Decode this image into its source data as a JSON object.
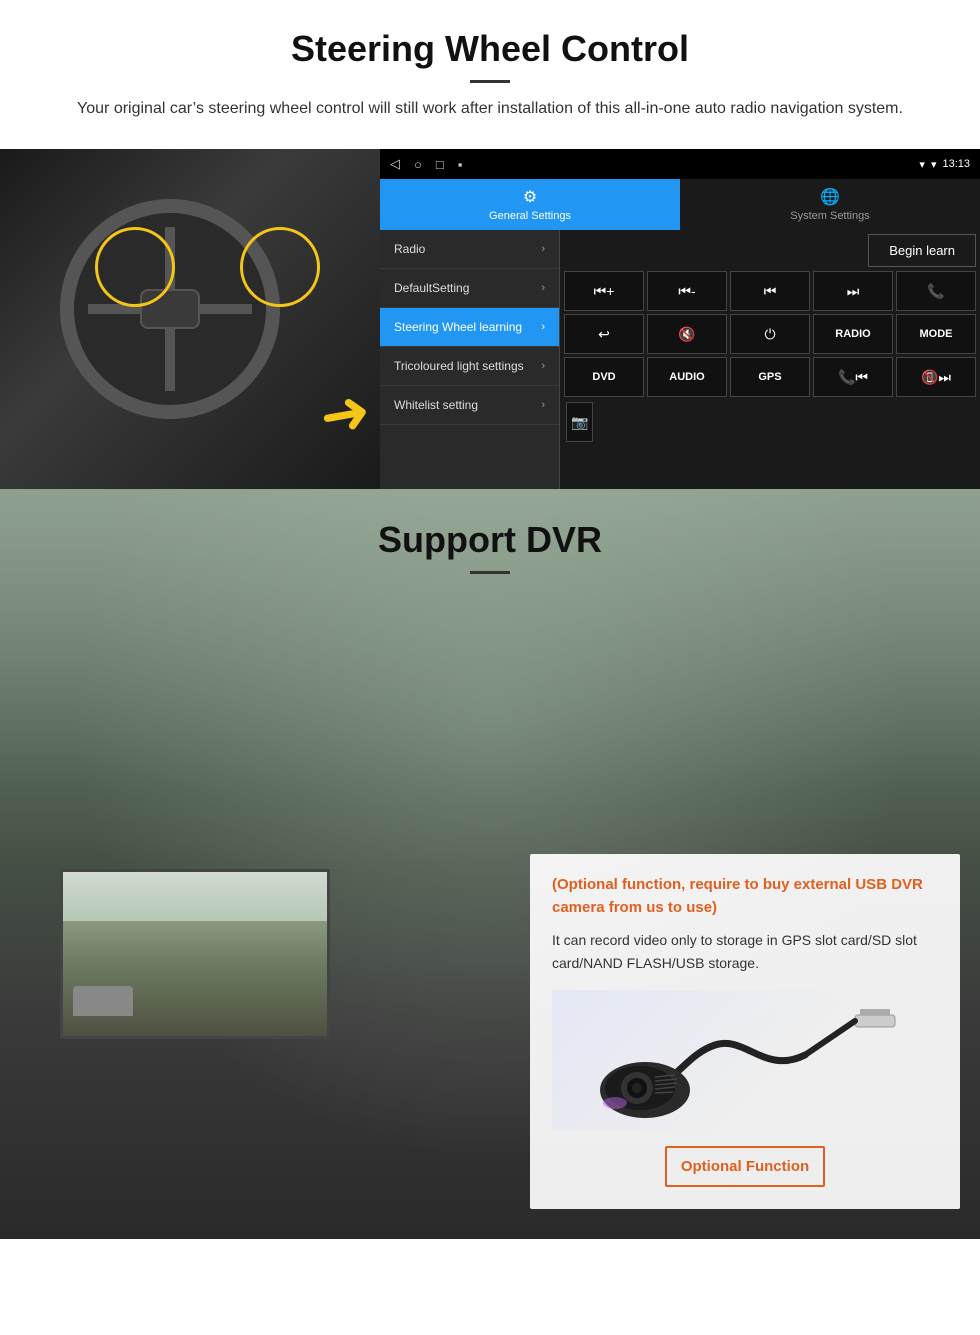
{
  "steering_section": {
    "title": "Steering Wheel Control",
    "description": "Your original car’s steering wheel control will still work after installation of this all-in-one auto radio navigation system.",
    "android_ui": {
      "statusbar": {
        "time": "13:13",
        "nav_icons": [
          "◁",
          "○",
          "□",
          "▪"
        ]
      },
      "tabs": [
        {
          "label": "General Settings",
          "icon": "⚙",
          "active": true
        },
        {
          "label": "System Settings",
          "icon": "🌐",
          "active": false
        }
      ],
      "menu_items": [
        {
          "label": "Radio",
          "active": false
        },
        {
          "label": "DefaultSetting",
          "active": false
        },
        {
          "label": "Steering Wheel learning",
          "active": true
        },
        {
          "label": "Tricoloured light settings",
          "active": false
        },
        {
          "label": "Whitelist setting",
          "active": false
        }
      ],
      "begin_learn": "Begin learn",
      "control_buttons_row1": [
        "⏮+",
        "⏮-",
        "⏮⏮",
        "⏭⏭",
        "📞"
      ],
      "control_buttons_row2": [
        "↩",
        "🔇",
        "⏻",
        "RADIO",
        "MODE"
      ],
      "control_buttons_row3": [
        "DVD",
        "AUDIO",
        "GPS",
        "📞⏮",
        "📵⏭"
      ],
      "control_buttons_row4": [
        "📹"
      ]
    }
  },
  "dvr_section": {
    "title": "Support DVR",
    "optional_text": "(Optional function, require to buy external USB DVR camera from us to use)",
    "description": "It can record video only to storage in GPS slot card/SD slot card/NAND FLASH/USB storage.",
    "optional_function_btn": "Optional Function"
  }
}
